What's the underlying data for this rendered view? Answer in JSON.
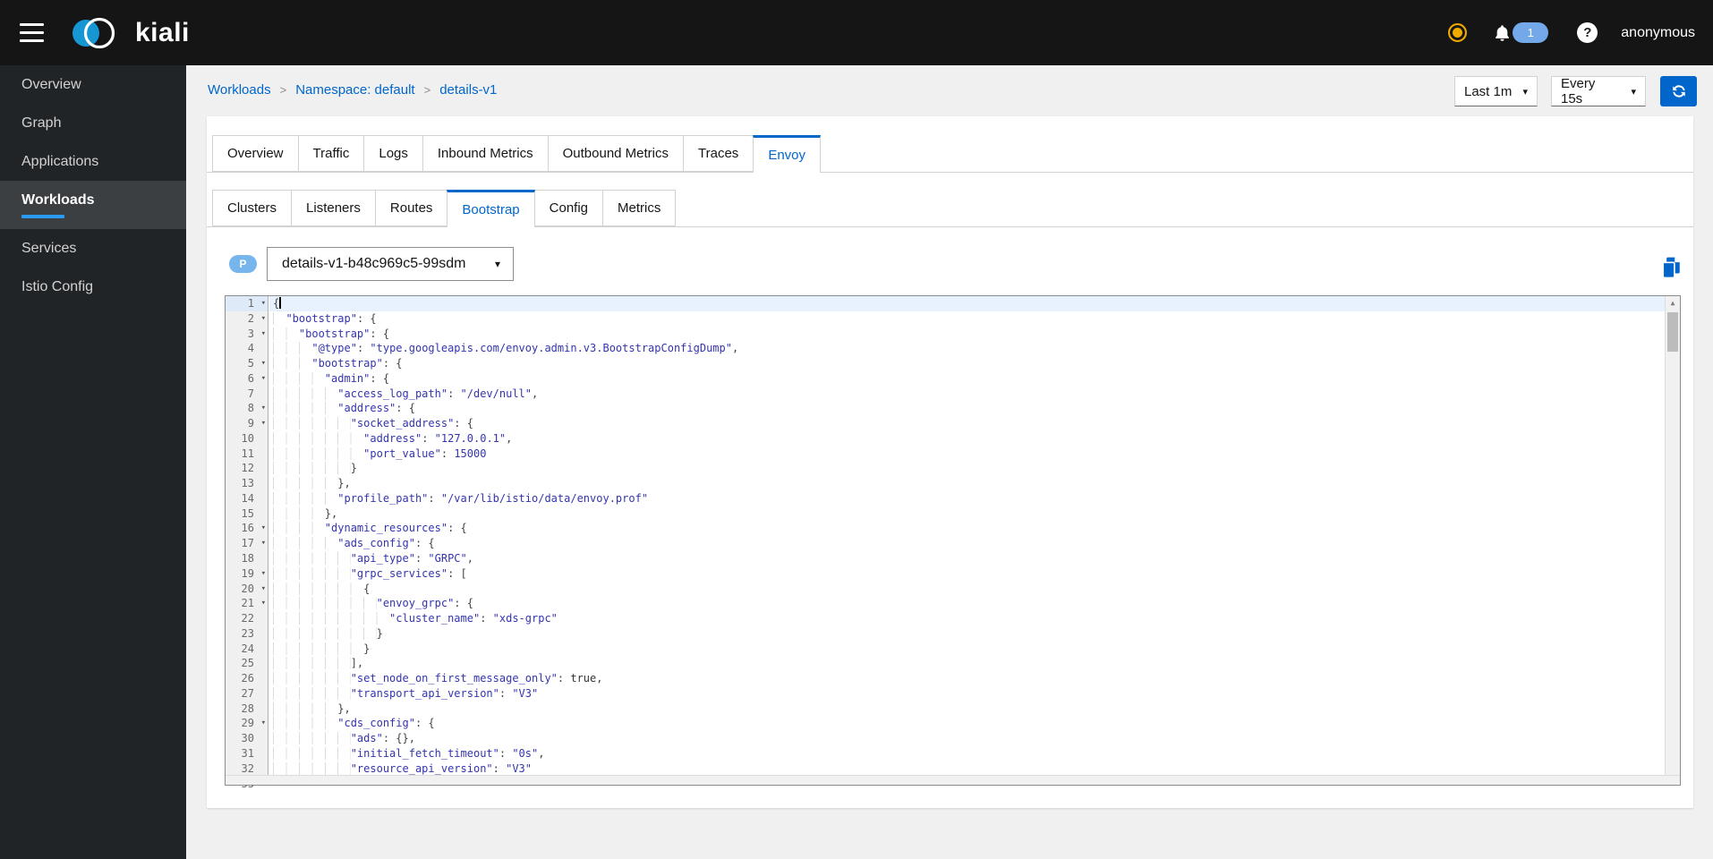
{
  "masthead": {
    "brand": "kiali",
    "user": "anonymous",
    "notifications": "1"
  },
  "sidebar": {
    "items": [
      {
        "label": "Overview",
        "active": false
      },
      {
        "label": "Graph",
        "active": false
      },
      {
        "label": "Applications",
        "active": false
      },
      {
        "label": "Workloads",
        "active": true
      },
      {
        "label": "Services",
        "active": false
      },
      {
        "label": "Istio Config",
        "active": false
      }
    ]
  },
  "breadcrumb": [
    "Workloads",
    "Namespace: default",
    "details-v1"
  ],
  "toolbar": {
    "duration": "Last 1m",
    "refresh": "Every 15s"
  },
  "tabs": {
    "items": [
      "Overview",
      "Traffic",
      "Logs",
      "Inbound Metrics",
      "Outbound Metrics",
      "Traces",
      "Envoy"
    ],
    "active": "Envoy"
  },
  "subtabs": {
    "items": [
      "Clusters",
      "Listeners",
      "Routes",
      "Bootstrap",
      "Config",
      "Metrics"
    ],
    "active": "Bootstrap"
  },
  "pod": {
    "badge": "P",
    "name": "details-v1-b48c969c5-99sdm"
  },
  "editor": {
    "active_line": 1,
    "fold_lines": [
      1,
      2,
      3,
      5,
      6,
      8,
      9,
      16,
      17,
      19,
      20,
      21,
      29
    ],
    "lines": [
      "{",
      "  \"bootstrap\": {",
      "    \"bootstrap\": {",
      "      \"@type\": \"type.googleapis.com/envoy.admin.v3.BootstrapConfigDump\",",
      "      \"bootstrap\": {",
      "        \"admin\": {",
      "          \"access_log_path\": \"/dev/null\",",
      "          \"address\": {",
      "            \"socket_address\": {",
      "              \"address\": \"127.0.0.1\",",
      "              \"port_value\": 15000",
      "            }",
      "          },",
      "          \"profile_path\": \"/var/lib/istio/data/envoy.prof\"",
      "        },",
      "        \"dynamic_resources\": {",
      "          \"ads_config\": {",
      "            \"api_type\": \"GRPC\",",
      "            \"grpc_services\": [",
      "              {",
      "                \"envoy_grpc\": {",
      "                  \"cluster_name\": \"xds-grpc\"",
      "                }",
      "              }",
      "            ],",
      "            \"set_node_on_first_message_only\": true,",
      "            \"transport_api_version\": \"V3\"",
      "          },",
      "          \"cds_config\": {",
      "            \"ads\": {},",
      "            \"initial_fetch_timeout\": \"0s\",",
      "            \"resource_api_version\": \"V3\"",
      "    "
    ]
  },
  "colors": {
    "accent": "#0066cc",
    "masthead_bg": "#151515",
    "sidebar_bg": "#212427",
    "sidebar_active_bg": "#3c3f42",
    "active_indicator": "#2b9af3",
    "notification_badge": "#73a9e8",
    "pod_badge": "#77b5ed",
    "warning_dot": "#f0ab00",
    "content_bg": "#f0f0f0",
    "tab_border": "#d2d2d2",
    "editor_active_line": "#e8f2fe",
    "code_string": "#3434b0",
    "code_plain": "#444444",
    "logo_blue": "#1697d4"
  }
}
